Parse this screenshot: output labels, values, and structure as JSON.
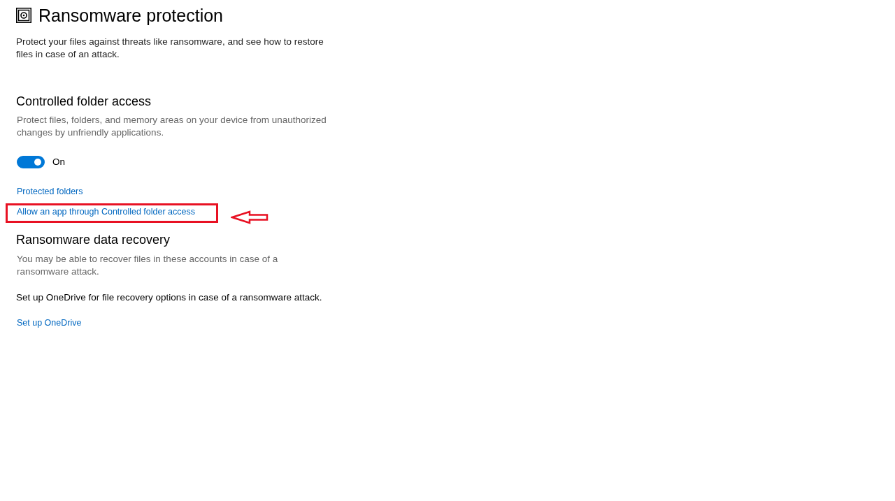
{
  "page": {
    "title": "Ransomware protection",
    "description": "Protect your files against threats like ransomware, and see how to restore files in case of an attack."
  },
  "sections": [
    {
      "heading": "Controlled folder access",
      "description": "Protect files, folders, and memory areas on your device from unauthorized changes by unfriendly applications.",
      "toggle": {
        "on": true,
        "label": "On"
      },
      "links": [
        {
          "label": "Protected folders",
          "highlighted": false
        },
        {
          "label": "Allow an app through Controlled folder access",
          "highlighted": true
        }
      ]
    },
    {
      "heading": "Ransomware data recovery",
      "description": "You may be able to recover files in these accounts in case of a ransomware attack.",
      "note": "Set up OneDrive for file recovery options in case of a ransomware attack.",
      "links": [
        {
          "label": "Set up OneDrive",
          "highlighted": false
        }
      ]
    }
  ]
}
